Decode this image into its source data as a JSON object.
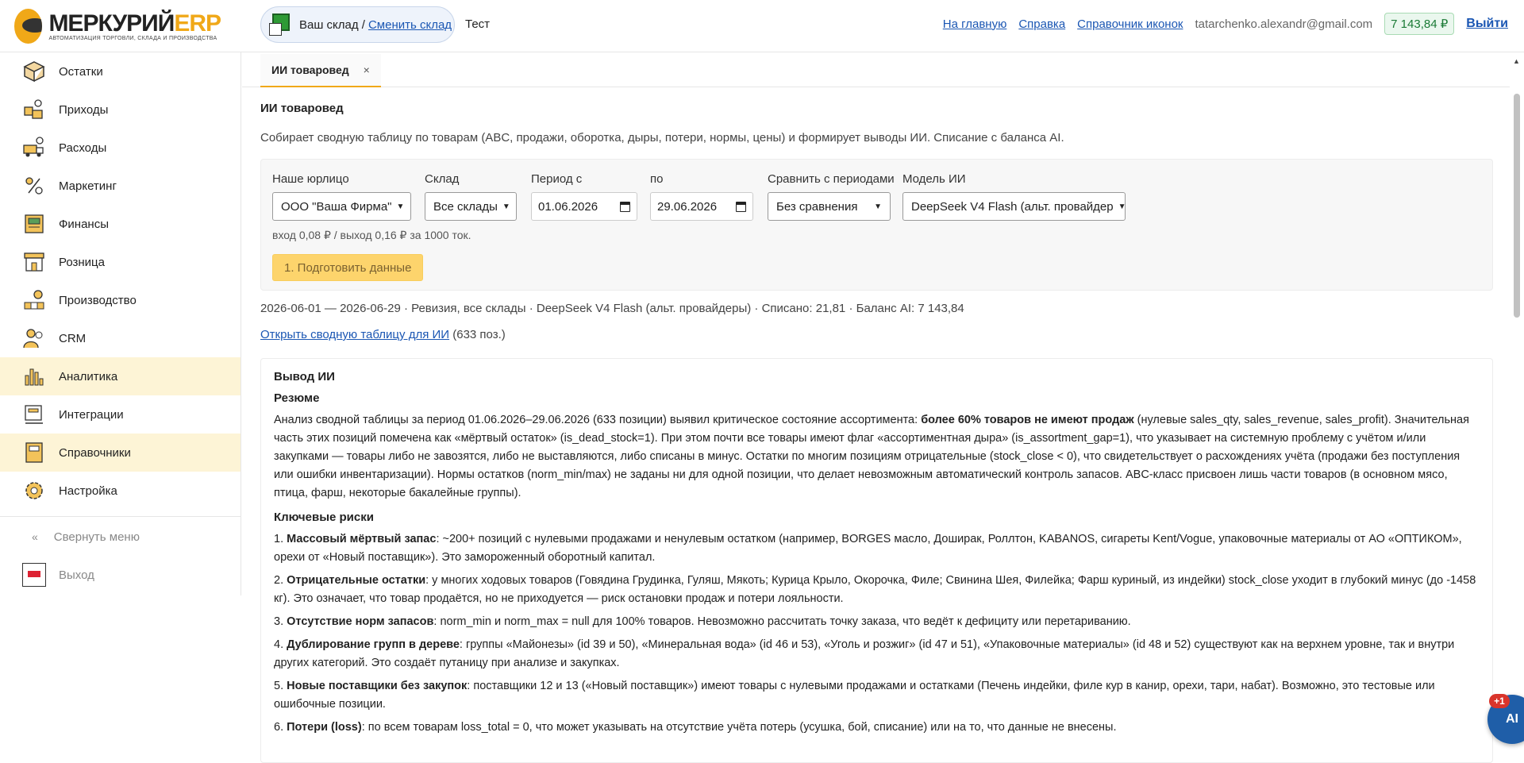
{
  "header": {
    "logo_name": "МЕРКУРИЙ",
    "logo_erp": "ERP",
    "logo_sub": "АВТОМАТИЗАЦИЯ ТОРГОВЛИ, СКЛАДА И ПРОИЗВОДСТВА",
    "warehouse_label": "Ваш склад /",
    "warehouse_link": "Сменить склад",
    "test_label": "Тест",
    "links": [
      "На главную",
      "Справка",
      "Справочник иконок"
    ],
    "email": "tatarchenko.alexandr@gmail.com",
    "balance": "7 143,84 ₽",
    "logout": "Выйти"
  },
  "sidebar": {
    "items": [
      {
        "label": "Остатки",
        "icon": "box-icon"
      },
      {
        "label": "Приходы",
        "icon": "incoming-goods-icon"
      },
      {
        "label": "Расходы",
        "icon": "delivery-truck-icon"
      },
      {
        "label": "Маркетинг",
        "icon": "discount-icon"
      },
      {
        "label": "Финансы",
        "icon": "cash-register-icon"
      },
      {
        "label": "Розница",
        "icon": "storefront-icon"
      },
      {
        "label": "Производство",
        "icon": "factory-icon"
      },
      {
        "label": "CRM",
        "icon": "people-icon"
      },
      {
        "label": "Аналитика",
        "icon": "bar-chart-icon"
      },
      {
        "label": "Интеграции",
        "icon": "integration-icon"
      },
      {
        "label": "Справочники",
        "icon": "book-icon"
      },
      {
        "label": "Настройка",
        "icon": "gear-icon"
      }
    ],
    "collapse": "Свернуть меню",
    "exit": "Выход"
  },
  "tabs": [
    {
      "label": "ИИ товаровед",
      "close": "×"
    }
  ],
  "page": {
    "title": "ИИ товаровед",
    "description": "Собирает сводную таблицу по товарам (ABC, продажи, оборотка, дыры, потери, нормы, цены) и формирует выводы ИИ. Списание с баланса AI.",
    "filters": {
      "company_label": "Наше юрлицо",
      "company_value": "ООО \"Ваша Фирма\"",
      "warehouse_label": "Склад",
      "warehouse_value": "Все склады",
      "period_from_label": "Период с",
      "period_from_value": "01.06.2026",
      "period_to_label": "по",
      "period_to_value": "29.06.2026",
      "compare_label": "Сравнить с периодами",
      "compare_value": "Без сравнения",
      "model_label": "Модель ИИ",
      "model_value": "DeepSeek V4 Flash (альт. провайдер",
      "price_note": "вход 0,08 ₽ / выход 0,16 ₽ за 1000 ток.",
      "prepare_button": "1. Подготовить данные"
    },
    "summary_line": "2026-06-01 — 2026-06-29 · Ревизия, все склады · DeepSeek V4 Flash (альт. провайдеры) · Списано: 21,81 · Баланс AI: 7 143,84",
    "open_link": "Открыть сводную таблицу для ИИ",
    "open_count": "(633 поз.)"
  },
  "result": {
    "title": "Вывод ИИ",
    "resume_title": "Резюме",
    "resume_a": "Анализ сводной таблицы за период 01.06.2026–29.06.2026 (633 позиции) выявил критическое состояние ассортимента: ",
    "resume_b": "более 60% товаров не имеют продаж",
    "resume_c": " (нулевые sales_qty, sales_revenue, sales_profit). Значительная часть этих позиций помечена как «мёртвый остаток» (is_dead_stock=1). При этом почти все товары имеют флаг «ассортиментная дыра» (is_assortment_gap=1), что указывает на системную проблему с учётом и/или закупками — товары либо не завозятся, либо не выставляются, либо списаны в минус. Остатки по многим позициям отрицательные (stock_close < 0), что свидетельствует о расхождениях учёта (продажи без поступления или ошибки инвентаризации). Нормы остатков (norm_min/max) не заданы ни для одной позиции, что делает невозможным автоматический контроль запасов. ABC-класс присвоен лишь части товаров (в основном мясо, птица, фарш, некоторые бакалейные группы).",
    "risks_title": "Ключевые риски",
    "risks": [
      {
        "num": "1. ",
        "bold": "Массовый мёртвый запас",
        "text": ": ~200+ позиций с нулевыми продажами и ненулевым остатком (например, BORGES масло, Доширак, Роллтон, KABANOS, сигареты Kent/Vogue, упаковочные материалы от АО «ОПТИКОМ», орехи от «Новый поставщик»). Это замороженный оборотный капитал."
      },
      {
        "num": "2. ",
        "bold": "Отрицательные остатки",
        "text": ": у многих ходовых товаров (Говядина Грудинка, Гуляш, Мякоть; Курица Крыло, Окорочка, Филе; Свинина Шея, Филейка; Фарш куриный, из индейки) stock_close уходит в глубокий минус (до -1458 кг). Это означает, что товар продаётся, но не приходуется — риск остановки продаж и потери лояльности."
      },
      {
        "num": "3. ",
        "bold": "Отсутствие норм запасов",
        "text": ": norm_min и norm_max = null для 100% товаров. Невозможно рассчитать точку заказа, что ведёт к дефициту или перетариванию."
      },
      {
        "num": "4. ",
        "bold": "Дублирование групп в дереве",
        "text": ": группы «Майонезы» (id 39 и 50), «Минеральная вода» (id 46 и 53), «Уголь и розжиг» (id 47 и 51), «Упаковочные материалы» (id 48 и 52) существуют как на верхнем уровне, так и внутри других категорий. Это создаёт путаницу при анализе и закупках."
      },
      {
        "num": "5. ",
        "bold": "Новые поставщики без закупок",
        "text": ": поставщики 12 и 13 («Новый поставщик») имеют товары с нулевыми продажами и остатками (Печень индейки, филе кур в канир, орехи, тари, набат). Возможно, это тестовые или ошибочные позиции."
      },
      {
        "num": "6. ",
        "bold": "Потери (loss)",
        "text": ": по всем товарам loss_total = 0, что может указывать на отсутствие учёта потерь (усушка, бой, списание) или на то, что данные не внесены."
      }
    ]
  },
  "ai_fab": {
    "label": "AI",
    "badge": "+1"
  },
  "colors": {
    "accent": "#f0a818",
    "link": "#1a56b3",
    "active_nav": "#fdf4d6",
    "fab": "#1f5ea8"
  }
}
